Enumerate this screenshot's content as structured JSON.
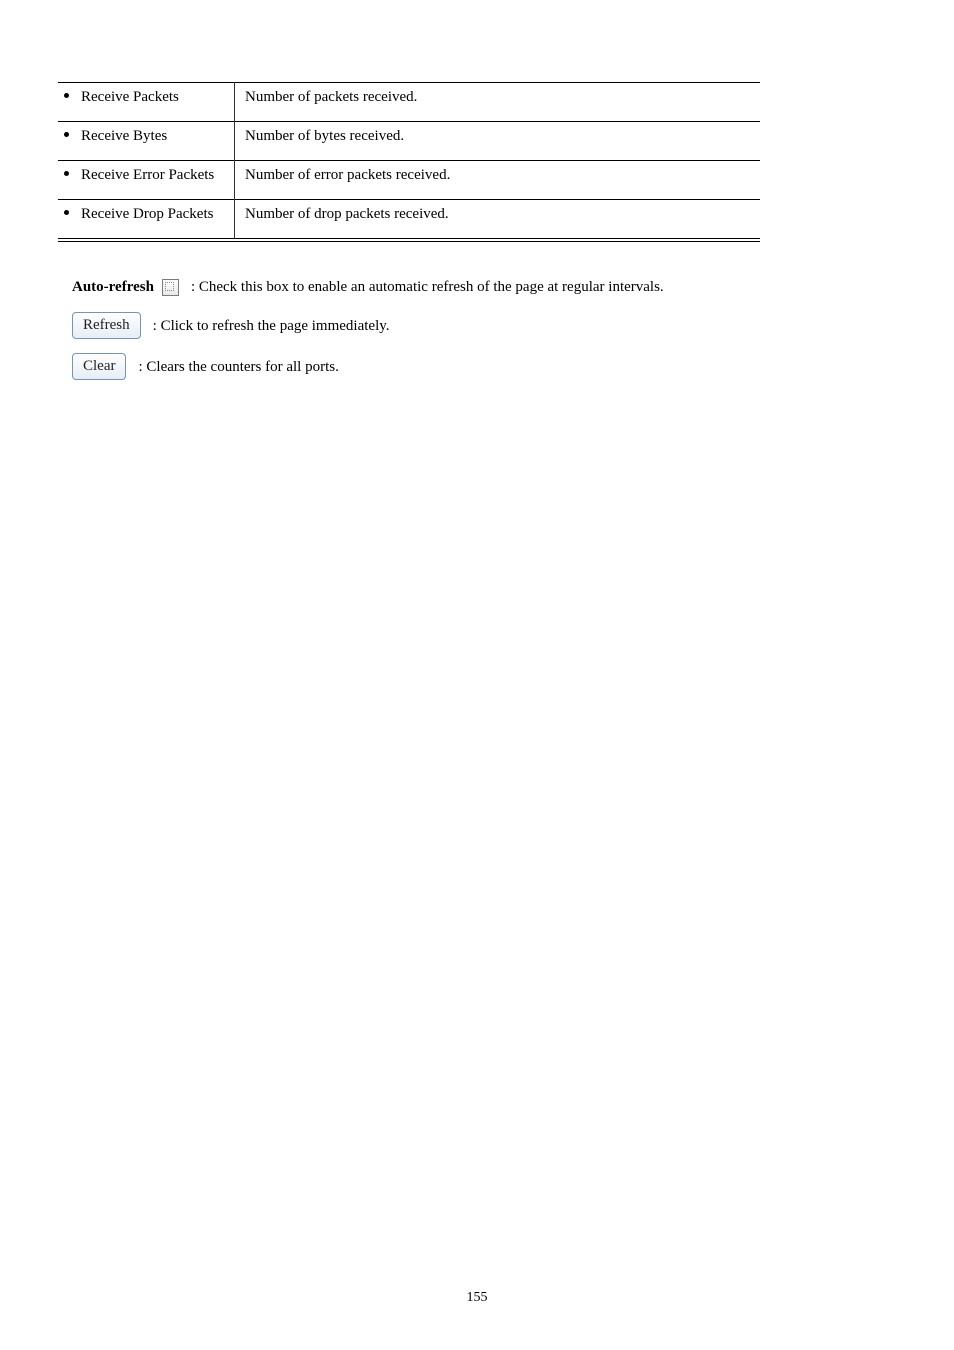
{
  "rows": [
    {
      "term": "Receive Packets",
      "desc": "Number of packets received."
    },
    {
      "term": "Receive Bytes",
      "desc": "Number of bytes received."
    },
    {
      "term": "Receive Error Packets",
      "desc": "Number of error packets received."
    },
    {
      "term": "Receive Drop Packets",
      "desc": "Number of drop packets received."
    }
  ],
  "controls": {
    "auto_refresh_label": "Auto-refresh",
    "auto_refresh_desc": ": Check this box to enable an automatic refresh of the page at regular intervals.",
    "refresh_btn": "Refresh",
    "refresh_desc": ": Click to refresh the page immediately.",
    "clear_btn": "Clear",
    "clear_desc": ": Clears the counters for all ports."
  },
  "footer": {
    "page_number": "155"
  }
}
